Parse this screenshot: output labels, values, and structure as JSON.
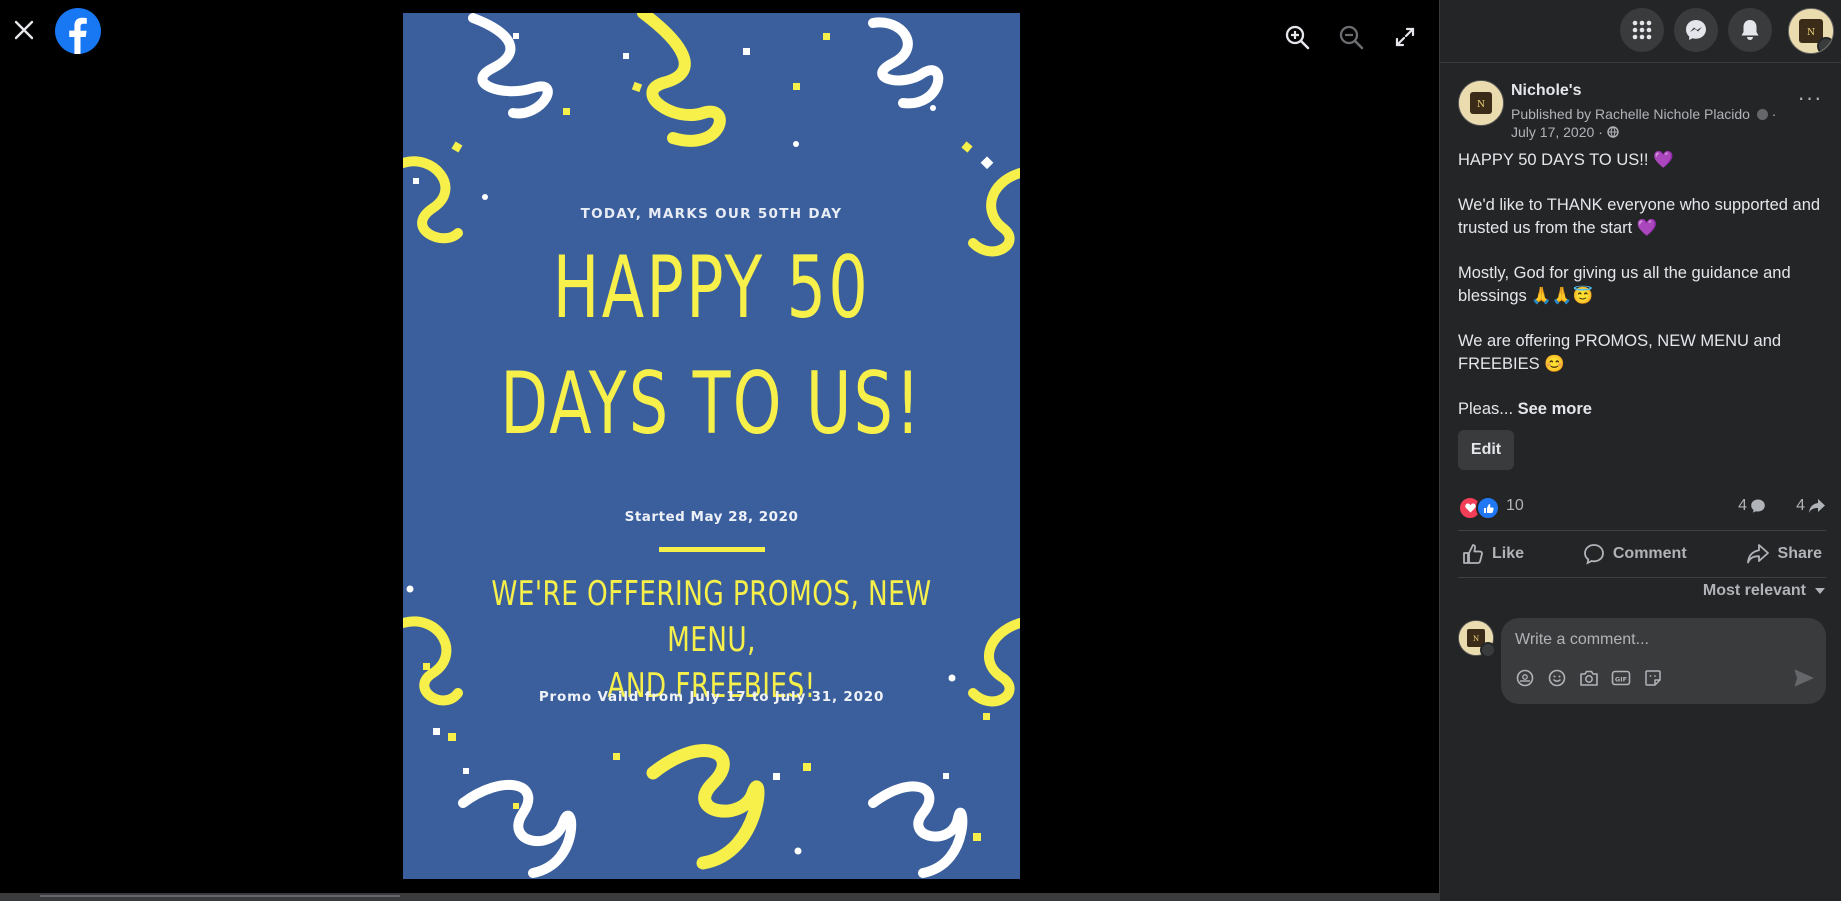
{
  "viewer": {
    "close_icon": "close-icon",
    "logo_icon": "facebook-logo-icon",
    "tools": [
      "zoom-in-icon",
      "zoom-out-icon",
      "fullscreen-icon"
    ],
    "poster": {
      "subheading": "TODAY, MARKS OUR 50TH DAY",
      "headline_line1": "HAPPY 50",
      "headline_line2": "DAYS TO US!",
      "started": "Started May 28, 2020",
      "offer_line1": "WE'RE OFFERING PROMOS, NEW MENU,",
      "offer_line2": "AND FREEBIES!",
      "validity": "Promo Vaild from July 17 to July 31, 2020",
      "background_color": "#3a5f9c",
      "accent_color": "#f7f04a"
    }
  },
  "topnav": {
    "icons": [
      "menu-grid-icon",
      "messenger-icon",
      "notifications-bell-icon",
      "account-avatar"
    ]
  },
  "post": {
    "page_name": "Nichole's",
    "published_by": "Published by Rachelle Nichole Placido",
    "date": "July 17, 2020",
    "more_icon": "more-options-icon",
    "paragraphs": [
      "HAPPY 50 DAYS TO US!!",
      "We'd like to THANK everyone who supported and trusted us from the start",
      "Mostly, God for giving us all the guidance and blessings",
      "We are offering PROMOS, NEW MENU and FREEBIES"
    ],
    "emojis": [
      "💜",
      "💜",
      "🙏🙏😇",
      "😊"
    ],
    "truncated_text": "Pleas...",
    "see_more": "See more",
    "edit_label": "Edit"
  },
  "stats": {
    "reaction_count": "10",
    "comment_count": "4",
    "share_count": "4"
  },
  "actions": {
    "like": "Like",
    "comment": "Comment",
    "share": "Share"
  },
  "comments": {
    "sort_label": "Most relevant",
    "placeholder": "Write a comment...",
    "tool_icons": [
      "avatar-sticker-icon",
      "emoji-icon",
      "camera-icon",
      "gif-icon",
      "sticker-icon"
    ],
    "send_icon": "send-icon"
  },
  "colors": {
    "panel_bg": "#242526",
    "button_bg": "#3a3b3c",
    "text_primary": "#e4e6eb",
    "text_secondary": "#b0b3b8",
    "facebook_blue": "#1877f2",
    "like_blue": "#2078f4",
    "love_red": "#f33e58"
  }
}
